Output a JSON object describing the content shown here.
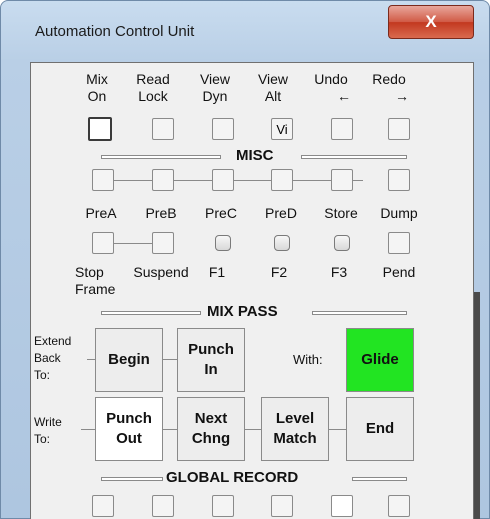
{
  "window": {
    "title": "Automation Control Unit",
    "close_glyph": "X"
  },
  "top_controls": [
    {
      "line1": "Mix",
      "line2": "On"
    },
    {
      "line1": "Read",
      "line2": "Lock"
    },
    {
      "line1": "View",
      "line2": "Dyn"
    },
    {
      "line1": "View",
      "line2": "Alt",
      "button_text": "Vi"
    },
    {
      "line1": "Undo",
      "arrow": "←"
    },
    {
      "line1": "Redo",
      "arrow": "→"
    }
  ],
  "misc": {
    "title": "MISC",
    "row1_labels": [
      "PreA",
      "PreB",
      "PreC",
      "PreD",
      "Store",
      "Dump"
    ],
    "row2_labels": [
      "Stop",
      "Suspend",
      "F1",
      "F2",
      "F3",
      "Pend"
    ],
    "row2_extra": "Frame"
  },
  "mix_pass": {
    "title": "MIX PASS",
    "extend_label": [
      "Extend",
      "Back",
      "To:"
    ],
    "begin": "Begin",
    "punch_in": [
      "Punch",
      "In"
    ],
    "with_label": "With:",
    "glide": "Glide",
    "write_label": [
      "Write",
      "To:"
    ],
    "punch_out": [
      "Punch",
      "Out"
    ],
    "next_chng": [
      "Next",
      "Chng"
    ],
    "level_match": [
      "Level",
      "Match"
    ],
    "end": "End"
  },
  "global_record": {
    "title": "GLOBAL RECORD"
  }
}
